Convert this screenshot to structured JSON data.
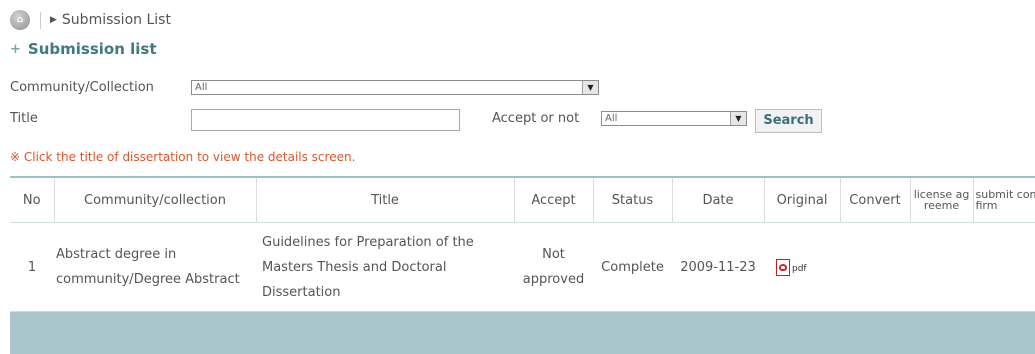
{
  "breadcrumb": {
    "current": "Submission List"
  },
  "page": {
    "title": "Submission list"
  },
  "filters": {
    "community_label": "Community/Collection",
    "community_value": "All",
    "title_label": "Title",
    "title_value": "",
    "accept_label": "Accept or not",
    "accept_value": "All",
    "search_label": "Search"
  },
  "notice": "※ Click the title of dissertation to view the details screen.",
  "table": {
    "headers": {
      "no": "No",
      "community": "Community/collection",
      "title": "Title",
      "accept": "Accept",
      "status": "Status",
      "date": "Date",
      "original": "Original",
      "convert": "Convert",
      "license": "license agreeme",
      "submit": "submit confirm"
    },
    "rows": [
      {
        "no": "1",
        "community": "Abstract degree in community/Degree Abstract",
        "title": "Guidelines for Preparation of the Masters Thesis and Doctoral Dissertation",
        "accept": "Not approved",
        "status": "Complete",
        "date": "2009-11-23",
        "original_label": "pdf",
        "original_icon": "pdf-file-icon"
      }
    ]
  },
  "colors": {
    "title": "#3d7a82",
    "notice": "#e0542a",
    "header_border": "#9cc1c7",
    "footer_band": "#a9c5cb"
  }
}
